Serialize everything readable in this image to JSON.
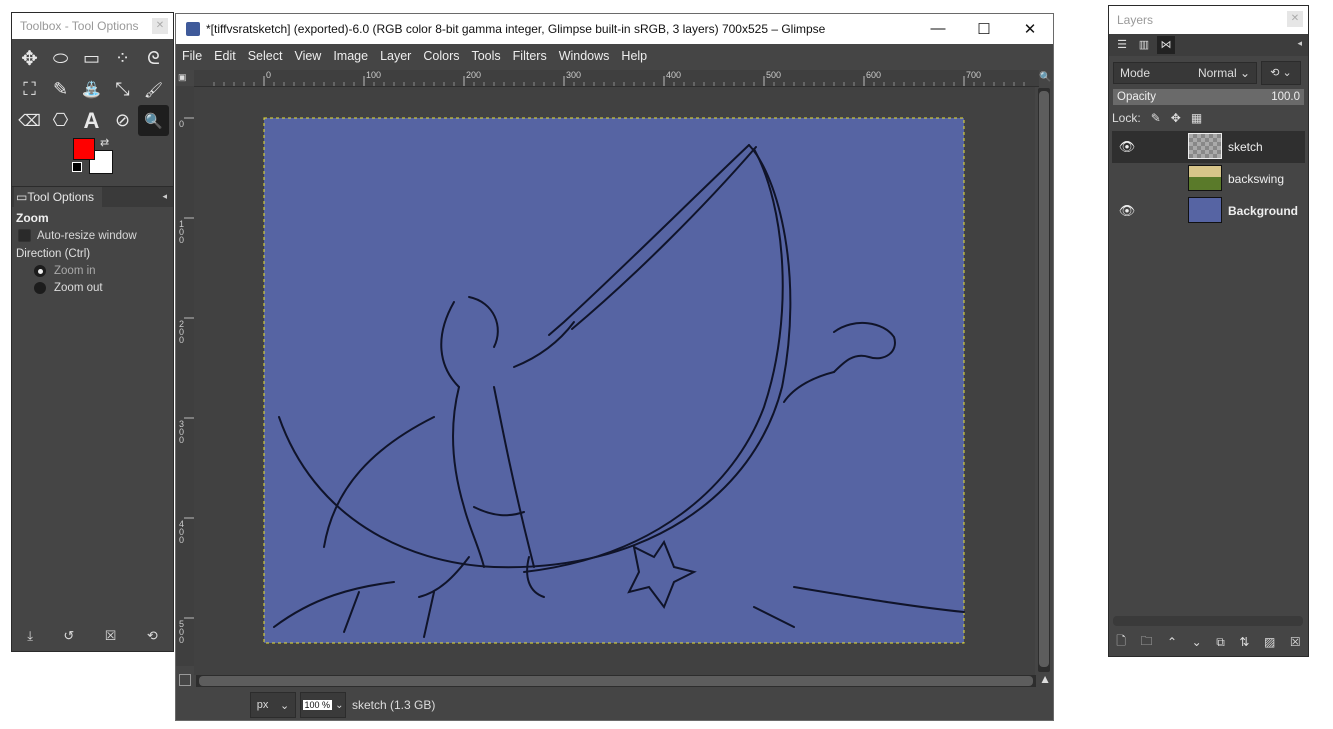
{
  "toolbox": {
    "title": "Toolbox - Tool Options",
    "tools": [
      {
        "name": "move",
        "glyph": "✥"
      },
      {
        "name": "ellipse-select",
        "glyph": "⬭"
      },
      {
        "name": "rect-select",
        "glyph": "▭"
      },
      {
        "name": "fuzzy-select",
        "glyph": "⁘"
      },
      {
        "name": "free-select",
        "glyph": "ᘓ"
      },
      {
        "name": "bucket-fill",
        "glyph": "⛶"
      },
      {
        "name": "pencil",
        "glyph": "✎"
      },
      {
        "name": "clone",
        "glyph": "⛲"
      },
      {
        "name": "transform",
        "glyph": "⤡"
      },
      {
        "name": "paintbrush",
        "glyph": "🖌"
      },
      {
        "name": "eraser",
        "glyph": "⌫"
      },
      {
        "name": "paths",
        "glyph": "⎔"
      },
      {
        "name": "text",
        "glyph": "A"
      },
      {
        "name": "color-picker",
        "glyph": "⊘"
      },
      {
        "name": "zoom",
        "glyph": "🔍"
      }
    ],
    "fg_color": "#ff0000",
    "bg_color": "#ffffff",
    "tab_label": "Tool Options",
    "options_heading": "Zoom",
    "auto_resize": "Auto-resize window",
    "direction_label": "Direction  (Ctrl)",
    "zoom_in": "Zoom in",
    "zoom_out": "Zoom out"
  },
  "main": {
    "title": "*[tiffvsratsketch] (exported)-6.0 (RGB color 8-bit gamma integer, Glimpse built-in sRGB, 3 layers) 700x525 – Glimpse",
    "menu": [
      "File",
      "Edit",
      "Select",
      "View",
      "Image",
      "Layer",
      "Colors",
      "Tools",
      "Filters",
      "Windows",
      "Help"
    ],
    "ruler_h": [
      "0",
      "100",
      "200",
      "300",
      "400",
      "500",
      "600",
      "700"
    ],
    "ruler_v": [
      "0",
      "100",
      "200",
      "300",
      "400",
      "500"
    ],
    "canvas_color": "#5664a3",
    "unit": "px",
    "zoom": "100 %",
    "status": "sketch (1.3 GB)"
  },
  "layers": {
    "title": "Layers",
    "mode_label": "Mode",
    "mode_value": "Normal",
    "opacity_label": "Opacity",
    "opacity_value": "100.0",
    "lock_label": "Lock:",
    "items": [
      {
        "name": "sketch",
        "visible": true,
        "selected": true
      },
      {
        "name": "backswing",
        "visible": false,
        "selected": false
      },
      {
        "name": "Background",
        "visible": true,
        "selected": false
      }
    ]
  }
}
